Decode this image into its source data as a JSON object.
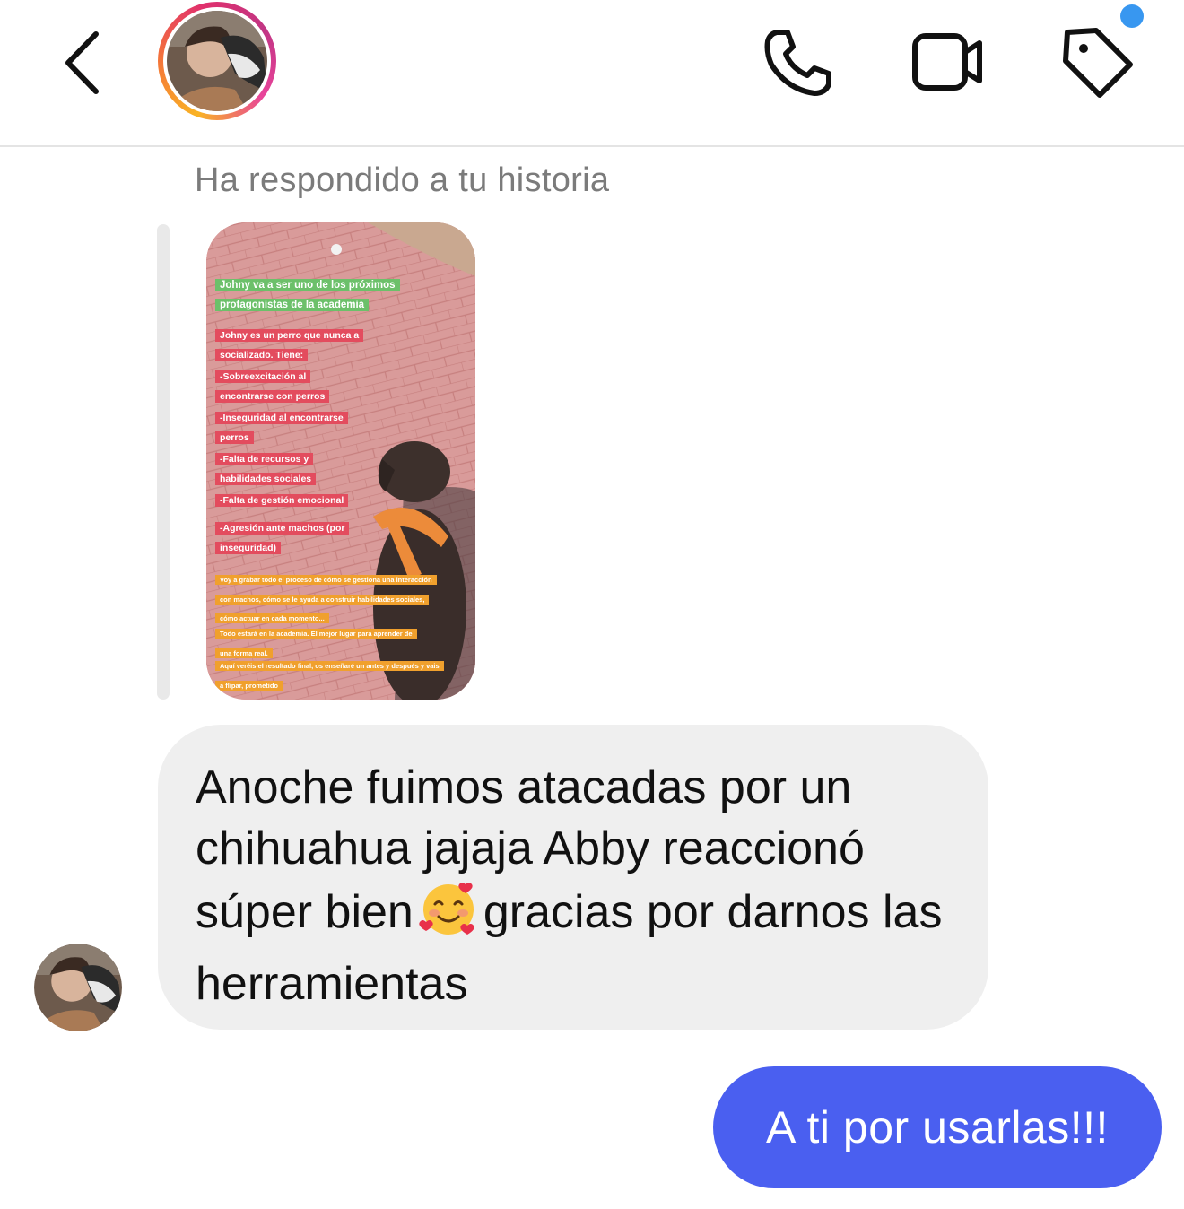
{
  "header": {
    "back_icon": "chevron-left-icon",
    "call_icon": "phone-icon",
    "video_icon": "video-camera-icon",
    "tag_icon": "tag-icon",
    "notification_color": "#3897f0"
  },
  "story_reply": {
    "caption": "Ha respondido a tu historia",
    "story_texts": {
      "headline": "Johny va a ser uno de los próximos protagonistas de la academia",
      "intro": "Johny es un perro que nunca a socializado. Tiene:",
      "point1": "-Sobreexcitación al encontrarse con perros",
      "point2": "-Inseguridad al encontrarse perros",
      "point3": "-Falta de recursos y habilidades sociales",
      "point4": "-Falta de gestión emocional",
      "point5": "-Agresión ante machos (por inseguridad)",
      "note1": "Voy a grabar todo el proceso de cómo se gestiona una interacción con machos, cómo se le ayuda a construir habilidades sociales, cómo actuar en cada momento...",
      "note2": "Todo estará en la academia. El mejor lugar para aprender de una forma real.",
      "note3": "Aquí veréis el resultado final, os enseñaré un antes y después y vais a flipar, prometido"
    }
  },
  "messages": {
    "incoming_part1": "Anoche fuimos atacadas por un chihuahua jajaja Abby reaccionó súper bien",
    "incoming_emoji": "smiling-face-with-hearts-emoji",
    "incoming_part2": "gracias por darnos las herramientas",
    "outgoing": "A ti por usarlas!!!"
  },
  "colors": {
    "incoming_bubble": "#efefef",
    "outgoing_bubble": "#4a5ff0",
    "story_ring": [
      "#f9b324",
      "#e1306c",
      "#c13584"
    ]
  }
}
